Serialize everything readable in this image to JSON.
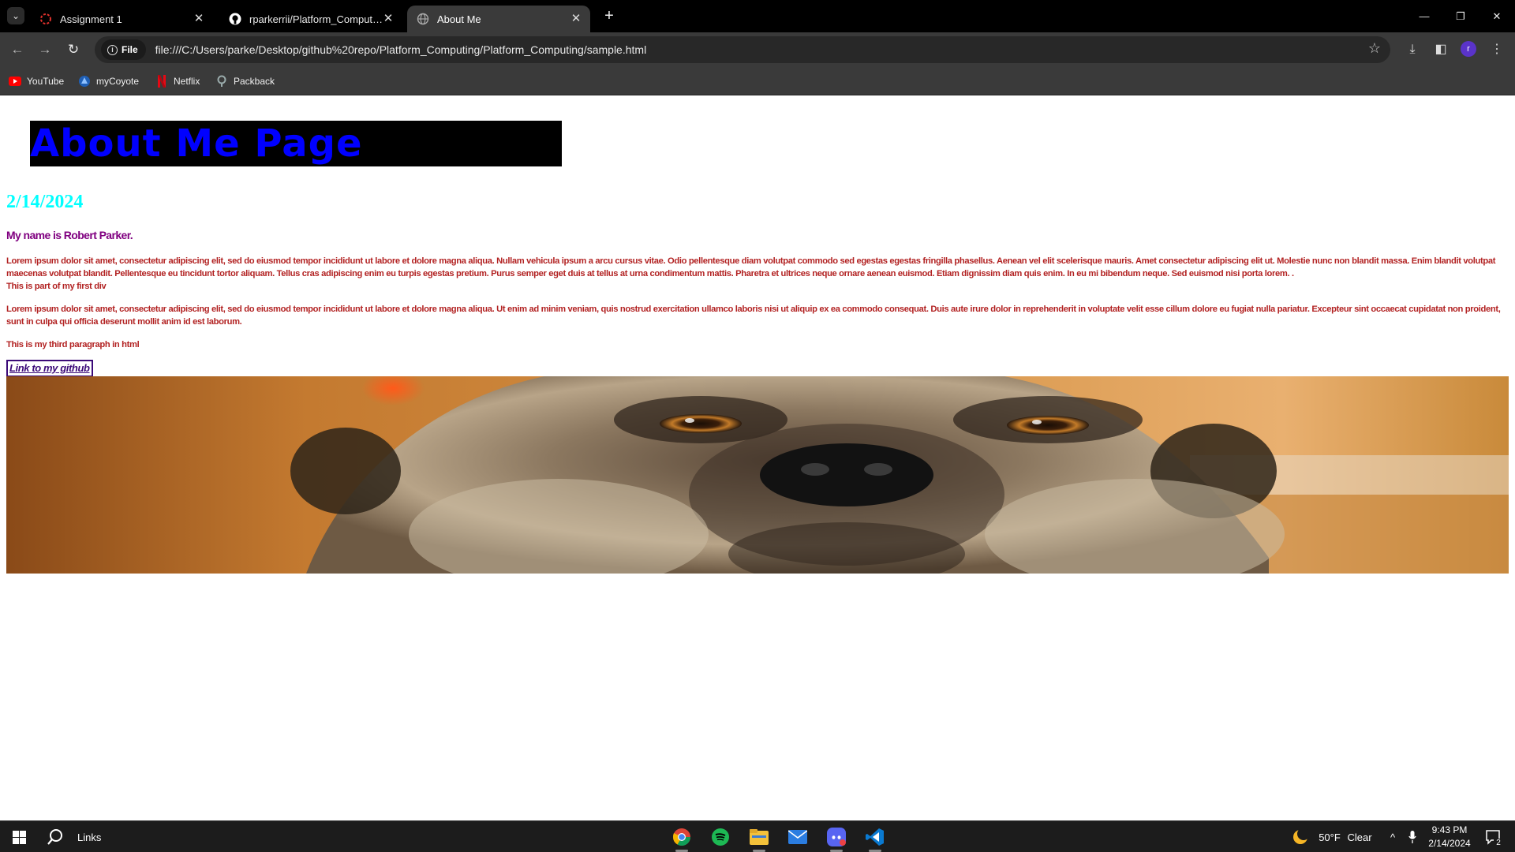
{
  "browser": {
    "tabs": [
      {
        "title": "Assignment 1",
        "icon": "loading-icon",
        "active": false
      },
      {
        "title": "rparkerrii/Platform_Computing",
        "icon": "github-icon",
        "active": false
      },
      {
        "title": "About Me",
        "icon": "globe-icon",
        "active": true
      }
    ],
    "address": {
      "chip_label": "File",
      "url": "file:///C:/Users/parke/Desktop/github%20repo/Platform_Computing/Platform_Computing/sample.html"
    },
    "profile_initial": "r",
    "bookmarks": [
      {
        "label": "YouTube",
        "icon": "youtube-icon"
      },
      {
        "label": "myCoyote",
        "icon": "mycoyote-icon"
      },
      {
        "label": "Netflix",
        "icon": "netflix-icon"
      },
      {
        "label": "Packback",
        "icon": "packback-icon"
      }
    ]
  },
  "page": {
    "heading": "About Me Page",
    "date": "2/14/2024",
    "intro": "My name is Robert Parker.",
    "paragraph1": "Lorem ipsum dolor sit amet, consectetur adipiscing elit, sed do eiusmod tempor incididunt ut labore et dolore magna aliqua. Nullam vehicula ipsum a arcu cursus vitae. Odio pellentesque diam volutpat commodo sed egestas egestas fringilla phasellus. Aenean vel elit scelerisque mauris. Amet consectetur adipiscing elit ut. Molestie nunc non blandit massa. Enim blandit volutpat maecenas volutpat blandit. Pellentesque eu tincidunt tortor aliquam. Tellus cras adipiscing enim eu turpis egestas pretium. Purus semper eget duis at tellus at urna condimentum mattis. Pharetra et ultrices neque ornare aenean euismod. Etiam dignissim diam quis enim. In eu mi bibendum neque. Sed euismod nisi porta lorem. .",
    "div_line": "This is part of my first div",
    "paragraph2": "Lorem ipsum dolor sit amet, consectetur adipiscing elit, sed do eiusmod tempor incididunt ut labore et dolore magna aliqua. Ut enim ad minim veniam, quis nostrud exercitation ullamco laboris nisi ut aliquip ex ea commodo consequat. Duis aute irure dolor in reprehenderit in voluptate velit esse cillum dolore eu fugiat nulla pariatur. Excepteur sint occaecat cupidatat non proident, sunt in culpa qui officia deserunt mollit anim id est laborum.",
    "paragraph3": "This is my third paragraph in html",
    "github_link": "Link to my github"
  },
  "taskbar": {
    "search_label": "Links",
    "weather": {
      "temp": "50°F",
      "condition": "Clear"
    },
    "time": "9:43 PM",
    "date": "2/14/2024",
    "notification_count": "2",
    "apps": [
      "chrome-icon",
      "spotify-icon",
      "file-explorer-icon",
      "mail-icon",
      "discord-icon",
      "vscode-icon"
    ]
  },
  "colors": {
    "heading_text": "#0000ff",
    "heading_bg": "#000000",
    "date_text": "#00ffff",
    "intro_text": "#800080",
    "paragraph_text": "#b22222",
    "link_text": "#3b0a78"
  }
}
